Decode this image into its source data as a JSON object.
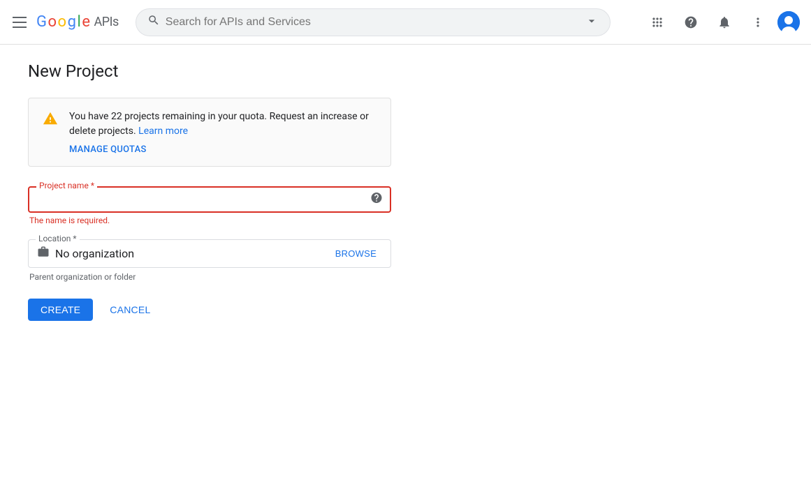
{
  "navbar": {
    "hamburger_label": "Menu",
    "logo": {
      "google": "Google",
      "apis": " APIs"
    },
    "search": {
      "placeholder": "Search for APIs and Services"
    },
    "icons": {
      "apps": "apps-icon",
      "help": "help-icon",
      "notifications": "notifications-icon",
      "more": "more-icon"
    }
  },
  "page": {
    "title": "New Project"
  },
  "alert": {
    "quota_message": "You have 22 projects remaining in your quota. Request an increase or delete projects.",
    "learn_more_label": "Learn more",
    "manage_quotas_label": "MANAGE QUOTAS"
  },
  "form": {
    "project_name": {
      "label": "Project name",
      "required_indicator": "*",
      "placeholder": "",
      "value": "",
      "error_message": "The name is required."
    },
    "location": {
      "label": "Location",
      "required_indicator": "*",
      "value": "No organization",
      "hint": "Parent organization or folder",
      "browse_label": "BROWSE"
    }
  },
  "buttons": {
    "create_label": "CREATE",
    "cancel_label": "CANCEL"
  }
}
